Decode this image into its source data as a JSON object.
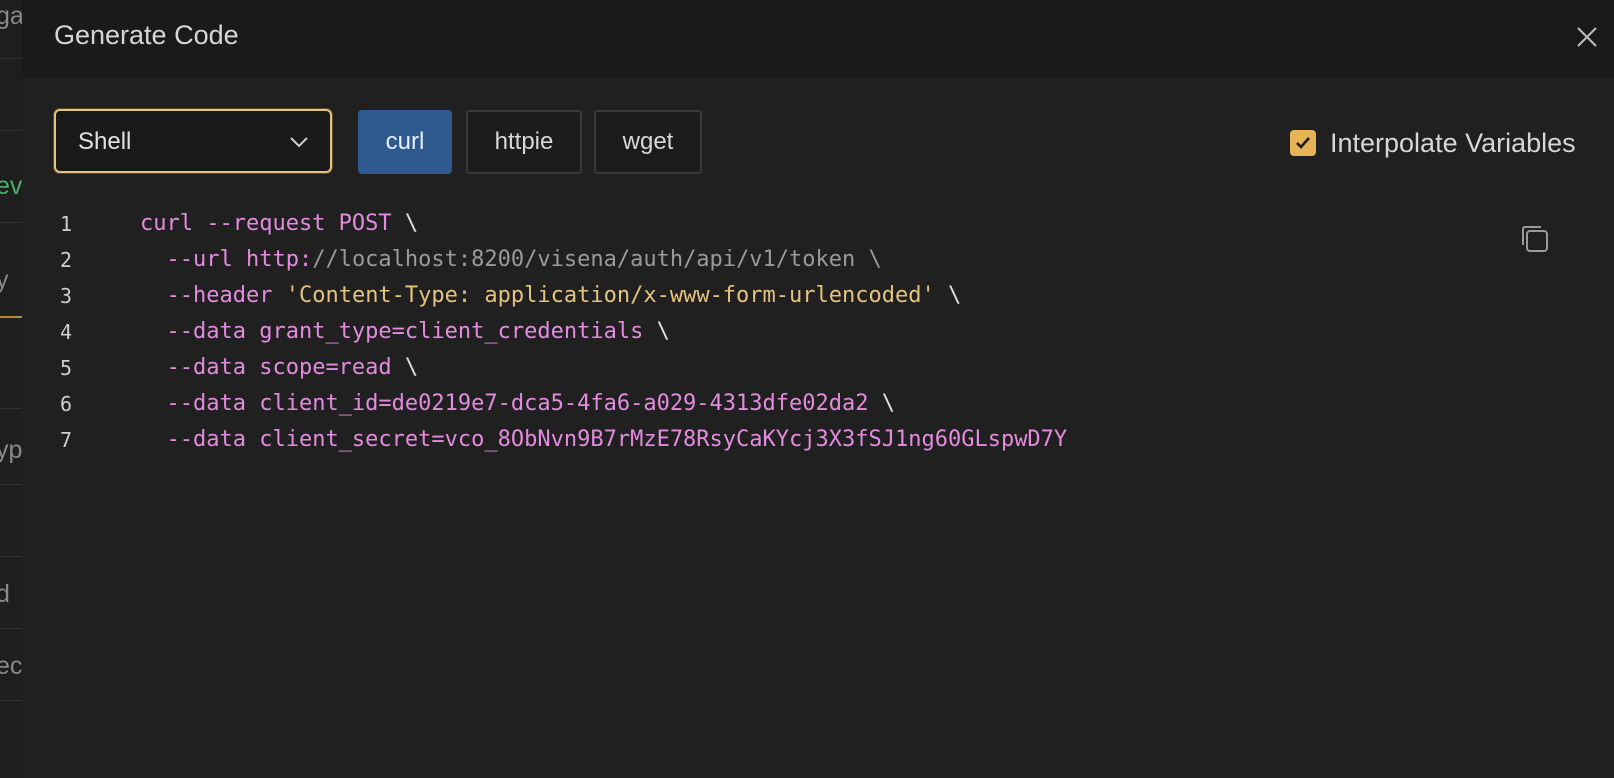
{
  "background": {
    "fragments": [
      "ga",
      "ev",
      "y",
      "yp",
      "d",
      "ec"
    ]
  },
  "dialog": {
    "title": "Generate Code"
  },
  "language_select": {
    "value": "Shell"
  },
  "client_tabs": [
    {
      "label": "curl",
      "active": true
    },
    {
      "label": "httpie",
      "active": false
    },
    {
      "label": "wget",
      "active": false
    }
  ],
  "interpolate": {
    "label": "Interpolate Variables",
    "checked": true
  },
  "code": {
    "lines": [
      {
        "number": "1",
        "tokens": [
          [
            "cmd",
            "curl --request POST "
          ],
          [
            "plain",
            "\\"
          ]
        ]
      },
      {
        "number": "2",
        "tokens": [
          [
            "plain",
            "  "
          ],
          [
            "cmd",
            "--url http:"
          ],
          [
            "url",
            "//localhost:8200/visena/auth/api/v1/token \\"
          ]
        ]
      },
      {
        "number": "3",
        "tokens": [
          [
            "plain",
            "  "
          ],
          [
            "cmd",
            "--header "
          ],
          [
            "str",
            "'Content-Type: application/x-www-form-urlencoded'"
          ],
          [
            "plain",
            " \\"
          ]
        ]
      },
      {
        "number": "4",
        "tokens": [
          [
            "plain",
            "  "
          ],
          [
            "cmd",
            "--data grant_type=client_credentials "
          ],
          [
            "plain",
            "\\"
          ]
        ]
      },
      {
        "number": "5",
        "tokens": [
          [
            "plain",
            "  "
          ],
          [
            "cmd",
            "--data scope=read "
          ],
          [
            "plain",
            "\\"
          ]
        ]
      },
      {
        "number": "6",
        "tokens": [
          [
            "plain",
            "  "
          ],
          [
            "cmd",
            "--data client_id=de0219e7-dca5-4fa6-a029-4313dfe02da2 "
          ],
          [
            "plain",
            "\\"
          ]
        ]
      },
      {
        "number": "7",
        "tokens": [
          [
            "plain",
            "  "
          ],
          [
            "cmd",
            "--data client_secret=vco_8ObNvn9B7rMzE78RsyCaKYcj3X3fSJ1ng60GLspwD7Y"
          ]
        ]
      }
    ]
  },
  "colors": {
    "accent": "#e5b454",
    "active_tab": "#2e5a8f",
    "keyword": "#e48be0",
    "string": "#e6c27f",
    "url": "#9a9a9a"
  }
}
